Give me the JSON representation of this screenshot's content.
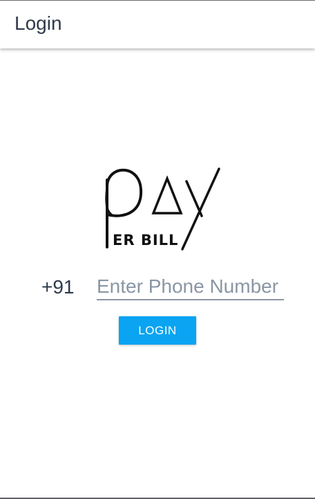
{
  "app_bar": {
    "title": "Login"
  },
  "logo": {
    "word": "pay",
    "tagline": "ER BILL"
  },
  "phone_form": {
    "country_code": "+91",
    "phone_placeholder": "Enter Phone Number",
    "phone_value": ""
  },
  "actions": {
    "login_label": "LOGIN"
  },
  "colors": {
    "accent": "#0aa4f2",
    "text": "#2e3a4a",
    "placeholder": "#8a96a4"
  }
}
